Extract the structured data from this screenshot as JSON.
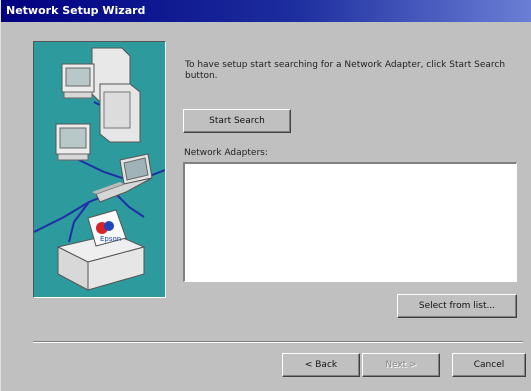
{
  "window": {
    "title": "Network Setup Wizard"
  },
  "instructions": "To have setup start searching for a Network Adapter, click Start Search button.",
  "buttons": {
    "start_search": "Start Search",
    "select_from_list": "Select from list...",
    "back": "< Back",
    "next": "Next >",
    "cancel": "Cancel"
  },
  "adapters": {
    "label": "Network Adapters:",
    "items": []
  },
  "illustration": {
    "printer_label": "Epson"
  }
}
